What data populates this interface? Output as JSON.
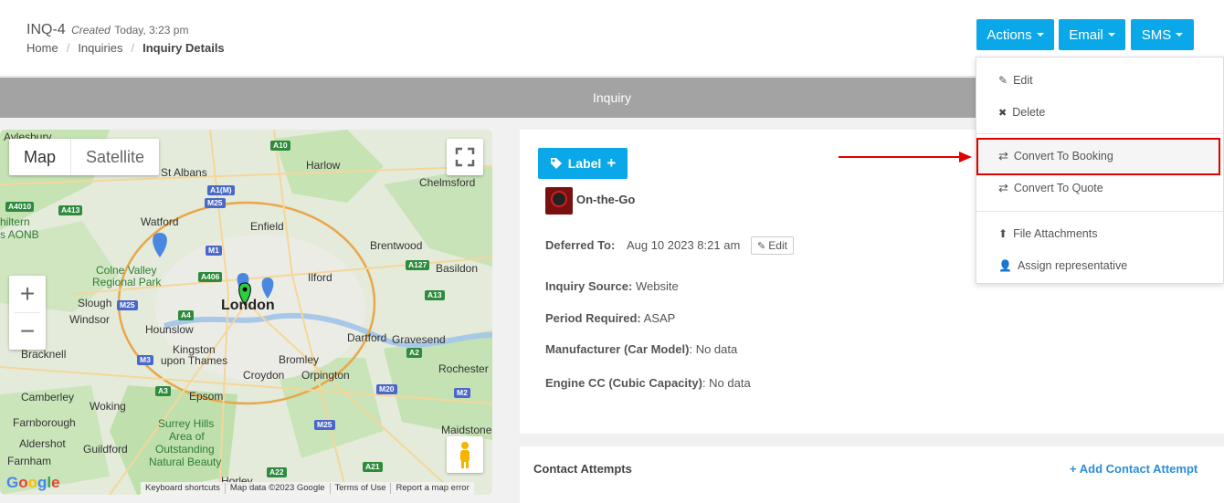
{
  "header": {
    "title": "INQ-4",
    "created_label": "Created",
    "created_time": "Today, 3:23 pm",
    "breadcrumb": [
      "Home",
      "Inquiries",
      "Inquiry Details"
    ],
    "actions_label": "Actions",
    "email_label": "Email",
    "sms_label": "SMS"
  },
  "banner": {
    "title": "Inquiry"
  },
  "actions_menu": {
    "items": [
      {
        "label": "Edit",
        "icon": "edit-icon"
      },
      {
        "label": "Delete",
        "icon": "delete-icon"
      },
      {
        "label": "Convert To Booking",
        "icon": "exchange-icon"
      },
      {
        "label": "Convert To Quote",
        "icon": "exchange-icon"
      },
      {
        "label": "File Attachments",
        "icon": "upload-icon"
      },
      {
        "label": "Assign representative",
        "icon": "user-plus-icon"
      }
    ]
  },
  "map": {
    "map_label": "Map",
    "satellite_label": "Satellite",
    "places": [
      "Aylesbury",
      "Harlow",
      "Chelmsford",
      "St Albans",
      "Watford",
      "Enfield",
      "Brentwood",
      "Basildon",
      "Colne Valley",
      "Regional Park",
      "Ilford",
      "Slough",
      "Windsor",
      "London",
      "Hounslow",
      "Kingston",
      "upon Thames",
      "Dartford",
      "Gravesend",
      "Bracknell",
      "Bromley",
      "Croydon",
      "Orpington",
      "Rochester",
      "Camberley",
      "Woking",
      "Epsom",
      "Farnborough",
      "Surrey Hills",
      "Area of",
      "Outstanding",
      "Natural Beauty",
      "Maidstone",
      "Aldershot",
      "Guildford",
      "Farnham",
      "Horley",
      "hiltern",
      "s AONB"
    ],
    "roads": [
      "A10",
      "A1(M)",
      "M25",
      "A4010",
      "A413",
      "M1",
      "A406",
      "A127",
      "A13",
      "M25",
      "A4",
      "A2",
      "M3",
      "A3",
      "M20",
      "M2",
      "M25",
      "A22",
      "A21"
    ],
    "footer": [
      "Keyboard shortcuts",
      "Map data ©2023 Google",
      "Terms of Use",
      "Report a map error"
    ],
    "logo": "Google"
  },
  "details": {
    "label_button": "Label",
    "company": "On-the-Go",
    "deferred_label": "Deferred To:",
    "deferred_value": "Aug 10 2023 8:21 am",
    "edit_label": "Edit",
    "source_label": "Inquiry Source:",
    "source_value": "Website",
    "period_label": "Period Required:",
    "period_value": "ASAP",
    "manufacturer_label": "Manufacturer (Car Model)",
    "manufacturer_value": ": No data",
    "engine_label": "Engine CC (Cubic Capacity)",
    "engine_value": ": No data"
  },
  "contact": {
    "title": "Contact Attempts",
    "add_label": "Add Contact Attempt"
  },
  "colors": {
    "accent": "#0aa8e8",
    "highlight": "#e00000",
    "link": "#2a8fd6"
  }
}
